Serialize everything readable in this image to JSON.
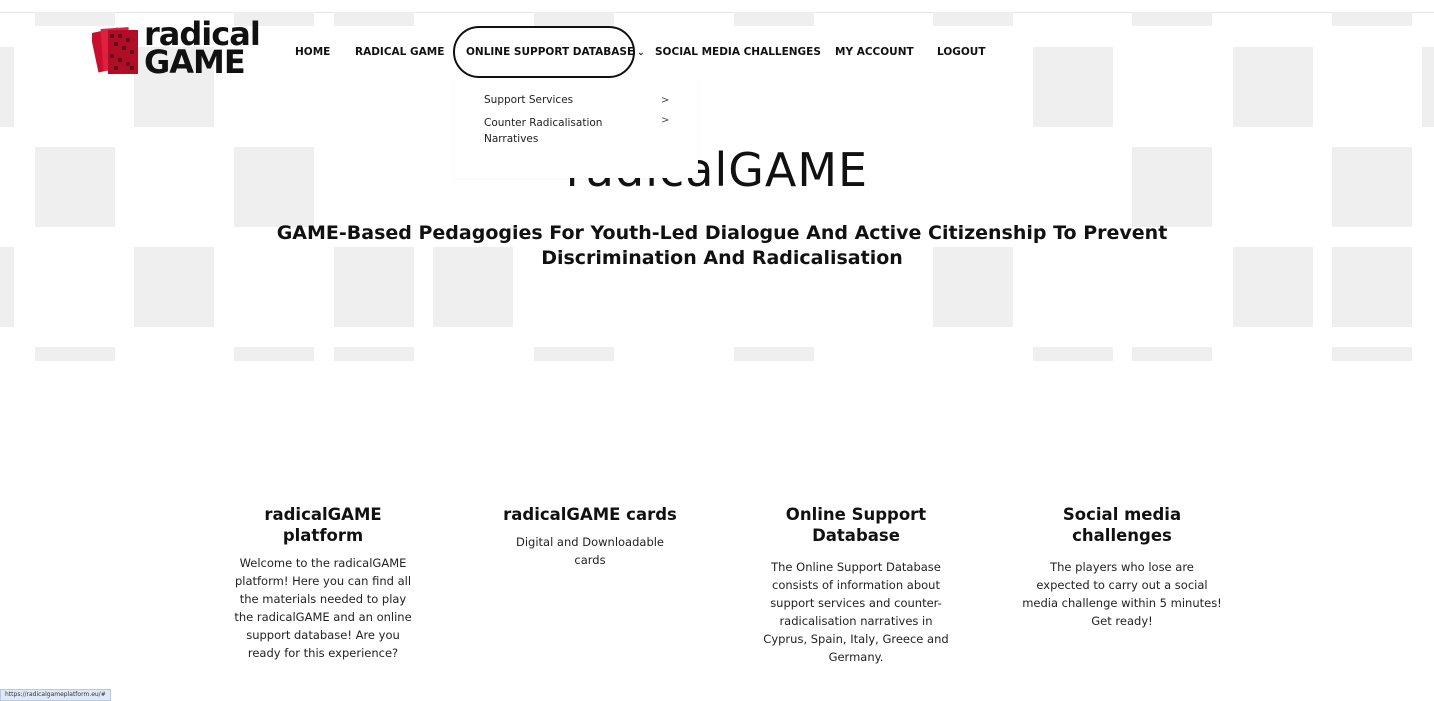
{
  "logo": {
    "line1": "radical",
    "line2": "GAME",
    "icon": "radicalgame-logo-mark"
  },
  "nav": {
    "items": [
      {
        "label": "HOME"
      },
      {
        "label": "RADICAL GAME"
      },
      {
        "label": "ONLINE SUPPORT DATABASE",
        "chevron": "chevron-down-icon"
      },
      {
        "label": "SOCIAL MEDIA CHALLENGES"
      },
      {
        "label": "MY ACCOUNT"
      },
      {
        "label": "LOGOUT"
      }
    ],
    "dropdown": [
      {
        "label": "Support Services",
        "arrow": ">"
      },
      {
        "label": "Counter Radicalisation Narratives",
        "arrow": ">"
      }
    ]
  },
  "hero": {
    "title": "radicalGAME",
    "subtitle": "GAME-Based Pedagogies For Youth-Led Dialogue And Active Citizenship To Prevent Discrimination And Radicalisation"
  },
  "cards": [
    {
      "title": "radicalGAME platform",
      "text": "Welcome to the radicalGAME platform! Here you can find all the materials needed to play the radicalGAME and an online support database! Are you ready for this experience?"
    },
    {
      "title": "radicalGAME cards",
      "text": "Digital and Downloadable cards"
    },
    {
      "title": "Online Support Database",
      "text": "The Online Support Database consists of information about support services and counter-radicalisation narratives in Cyprus, Spain, Italy, Greece and Germany."
    },
    {
      "title": "Social media challenges",
      "text": "The players who lose are expected to carry out a social media challenge within 5 minutes! Get ready!"
    }
  ],
  "status_bar": {
    "url": "https://radicalgameplatform.eu/#"
  },
  "colors": {
    "pattern": "#efefef",
    "logo_red": "#c8102e",
    "text": "#111111"
  }
}
